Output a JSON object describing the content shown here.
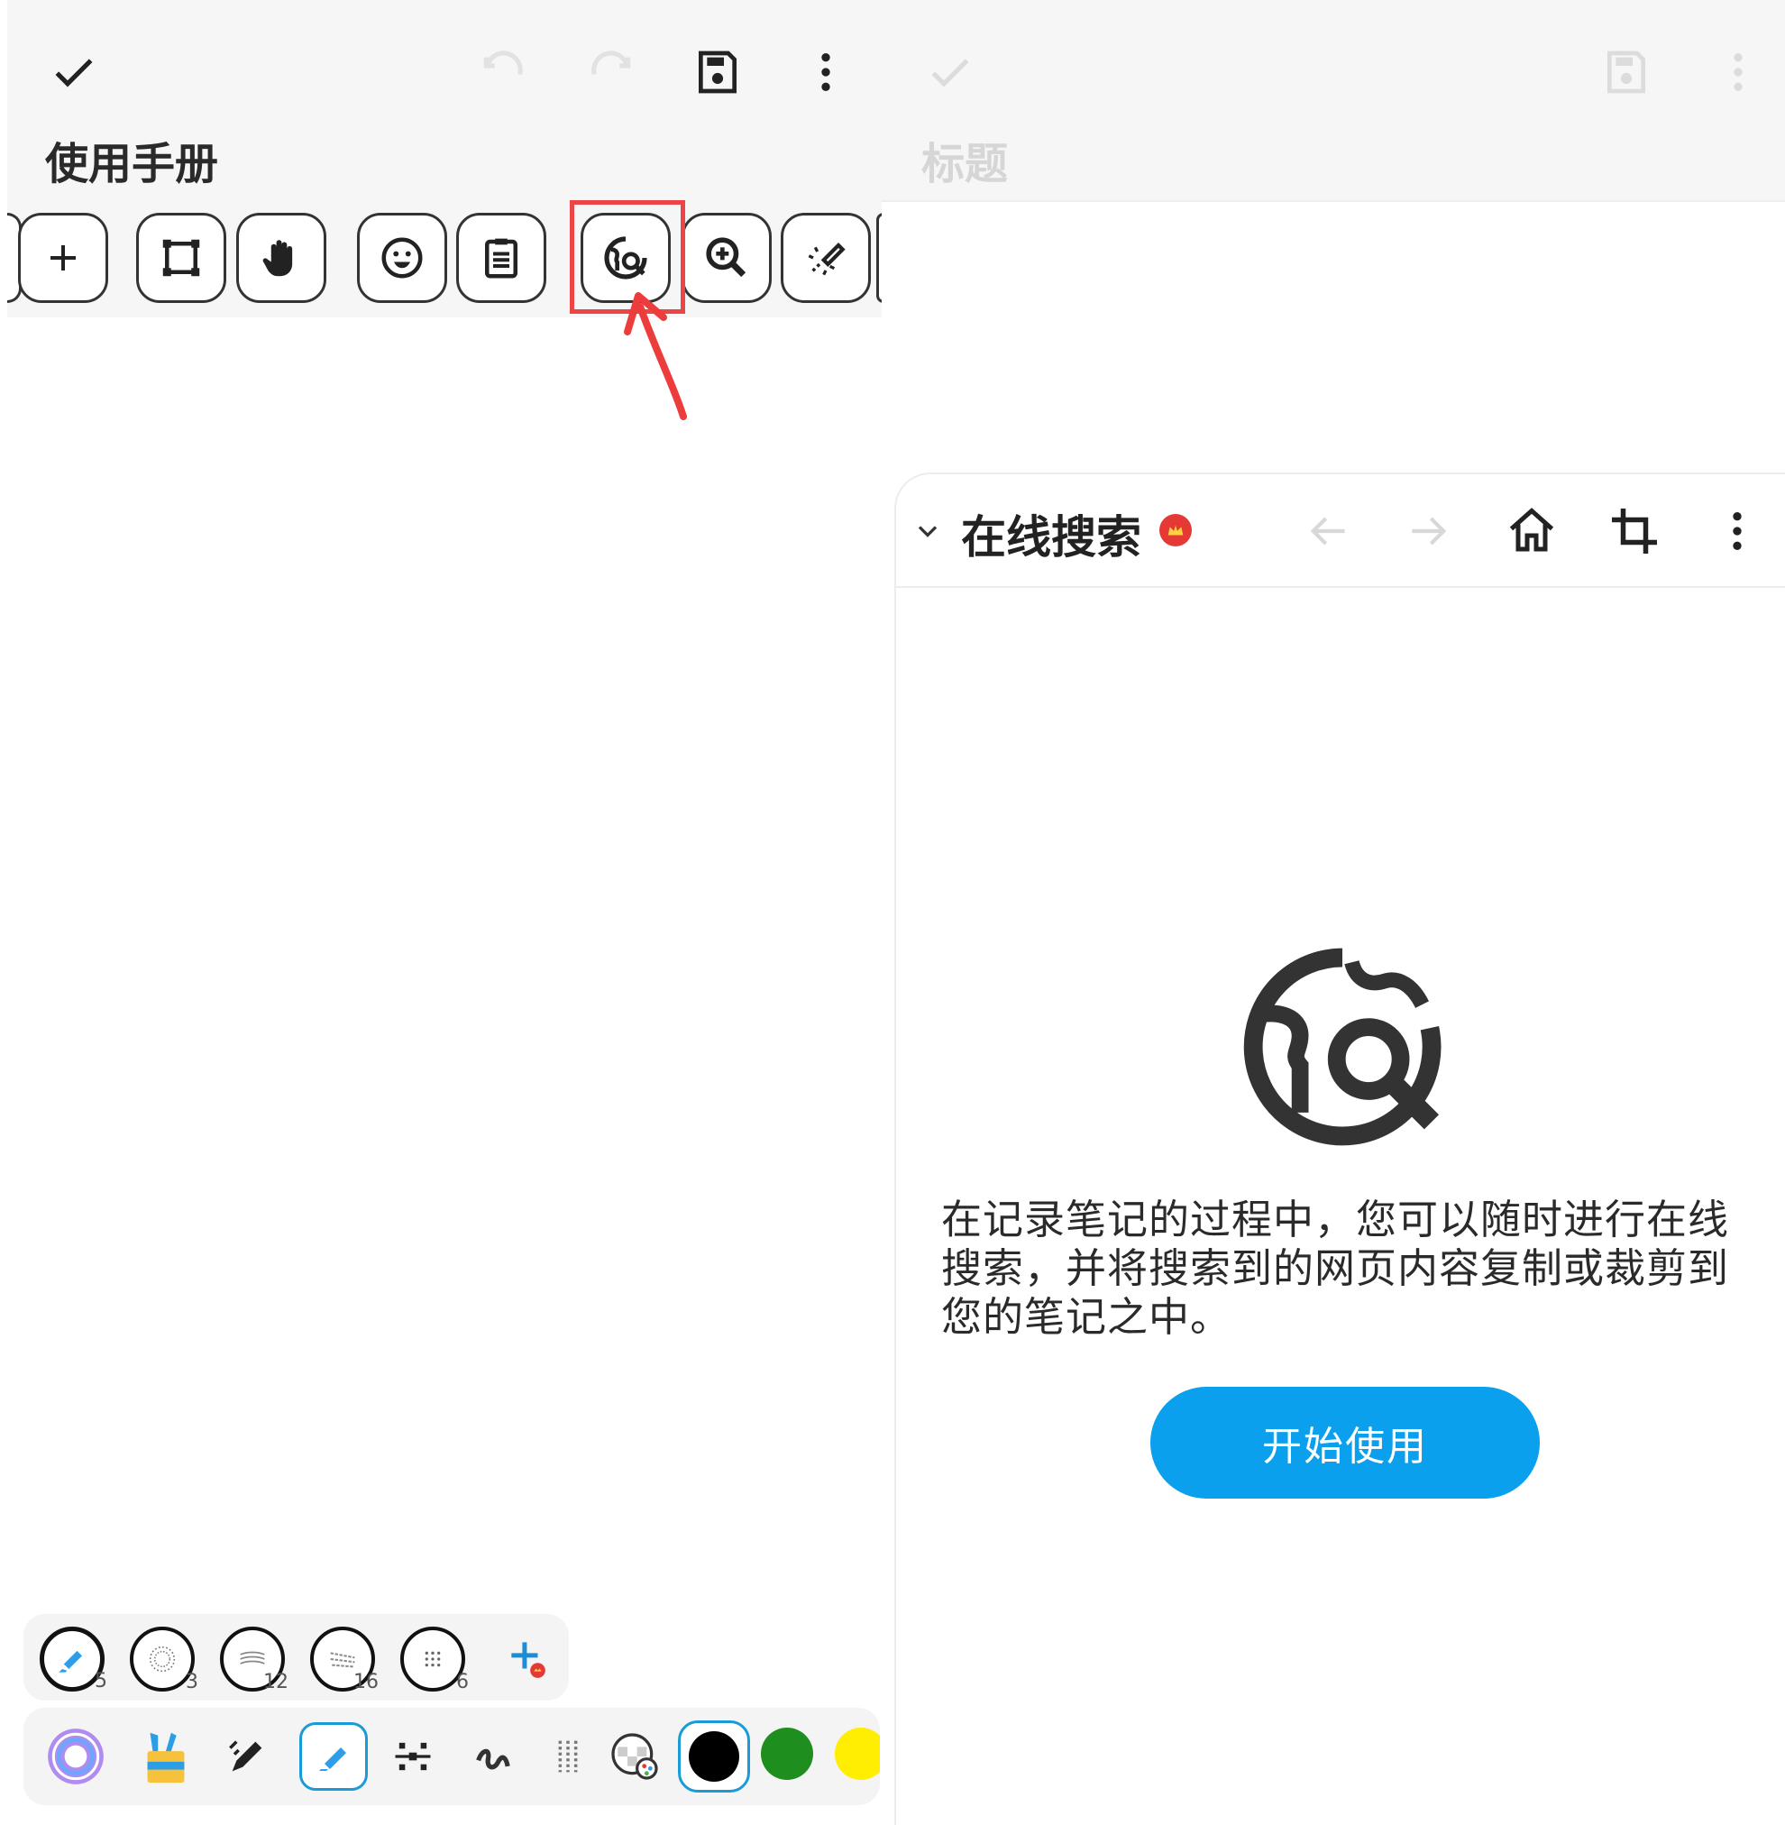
{
  "left": {
    "title": "使用手册",
    "toolbar": [
      "add",
      "select-rect",
      "hand",
      "emoji",
      "clipboard",
      "online-search",
      "zoom-in",
      "laser-pointer"
    ],
    "highlighted_tool": "online-search",
    "brushes": [
      {
        "icon": "marker",
        "size": "5"
      },
      {
        "icon": "texture-1",
        "size": "3"
      },
      {
        "icon": "texture-2",
        "size": "12"
      },
      {
        "icon": "texture-3",
        "size": "16"
      },
      {
        "icon": "texture-4",
        "size": "6"
      }
    ],
    "colors": {
      "accent_red": "#ec4545",
      "black": "#000000",
      "green": "#1e8e1e",
      "yellow": "#ffee00"
    }
  },
  "right": {
    "title": "标题",
    "sheet": {
      "title": "在线搜索",
      "description": "在记录笔记的过程中，您可以随时进行在线搜索，并将搜索到的网页内容复制或裁剪到您的笔记之中。",
      "button_label": "开始使用",
      "button_color": "#0aa0ee"
    }
  }
}
